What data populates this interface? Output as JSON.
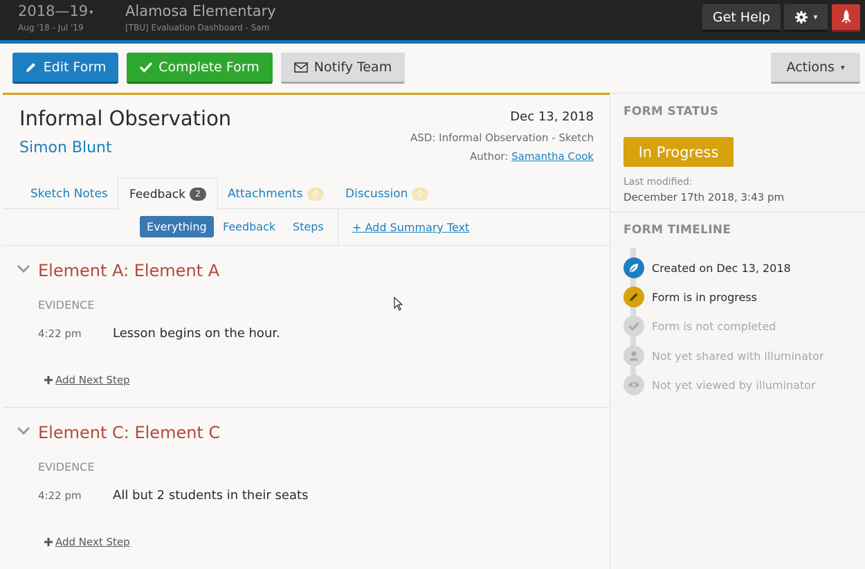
{
  "header": {
    "year": "2018—19",
    "year_range": "Aug '18 - Jul '19",
    "school": "Alamosa Elementary",
    "subtitle": "[TBU] Evaluation Dashboard - Sam",
    "help_label": "Get Help"
  },
  "toolbar": {
    "edit_label": "Edit Form",
    "complete_label": "Complete Form",
    "notify_label": "Notify Team",
    "actions_label": "Actions"
  },
  "form": {
    "title": "Informal Observation",
    "person": "Simon Blunt",
    "date": "Dec 13, 2018",
    "form_type": "ASD: Informal Observation - Sketch",
    "author_label": "Author:",
    "author_name": "Samantha Cook"
  },
  "tabs": [
    {
      "label": "Sketch Notes"
    },
    {
      "label": "Feedback",
      "count": "2"
    },
    {
      "label": "Attachments",
      "count": "0"
    },
    {
      "label": "Discussion",
      "count": "0"
    }
  ],
  "filters": {
    "items": [
      "Everything",
      "Feedback",
      "Steps"
    ],
    "add_summary": "+ Add Summary Text"
  },
  "elements": [
    {
      "title": "Element A: Element A",
      "evidence_label": "EVIDENCE",
      "time": "4:22 pm",
      "text": "Lesson begins on the hour.",
      "next_step": "Add Next Step"
    },
    {
      "title": "Element C: Element C",
      "evidence_label": "EVIDENCE",
      "time": "4:22 pm",
      "text": "All but 2 students in their seats",
      "next_step": "Add Next Step"
    }
  ],
  "status": {
    "heading": "FORM STATUS",
    "value": "In Progress",
    "last_modified_label": "Last modified:",
    "last_modified_value": "December 17th 2018, 3:43 pm"
  },
  "timeline": {
    "heading": "FORM TIMELINE",
    "items": [
      {
        "text": "Created on Dec 13, 2018",
        "icon": "leaf-icon",
        "color": "#1b7fc1"
      },
      {
        "text": "Form is in progress",
        "icon": "pencil-icon",
        "color": "#d6a20e"
      },
      {
        "text": "Form is not completed",
        "icon": "check-icon",
        "color": "#d6d6d6"
      },
      {
        "text": "Not yet shared with illuminator",
        "icon": "user-icon",
        "color": "#d6d6d6"
      },
      {
        "text": "Not yet viewed by illuminator",
        "icon": "eye-icon",
        "color": "#d6d6d6"
      }
    ]
  },
  "colors": {
    "accent_blue": "#1b7fc1",
    "success_green": "#2ea72e",
    "progress_gold": "#d6a20e",
    "element_red": "#b24a3a"
  }
}
